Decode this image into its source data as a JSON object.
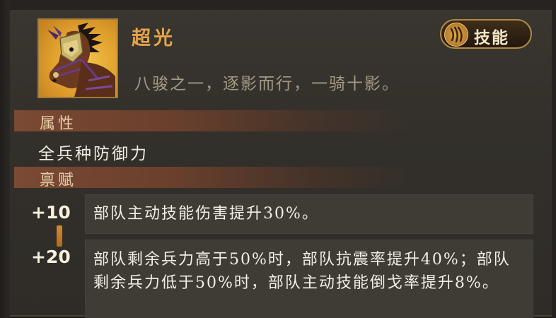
{
  "card": {
    "name": "超光",
    "description": "八骏之一，逐影而行，一骑十影。",
    "skill_button": "技能",
    "portrait_icon": "warhorse-portrait"
  },
  "sections": {
    "attribute_header": "属性",
    "attribute_value": "全兵种防御力",
    "talent_header": "禀赋"
  },
  "talents": [
    {
      "level": "+10",
      "text": "部队主动技能伤害提升30%。"
    },
    {
      "level": "+20",
      "text": "部队剩余兵力高于50%时，部队抗震率提升40%；部队剩余兵力低于50%时，部队主动技能倒戈率提升8%。"
    }
  ],
  "colors": {
    "name": "#e7a34a",
    "section_header": "#7a4a34",
    "connector": "#d3892e"
  }
}
